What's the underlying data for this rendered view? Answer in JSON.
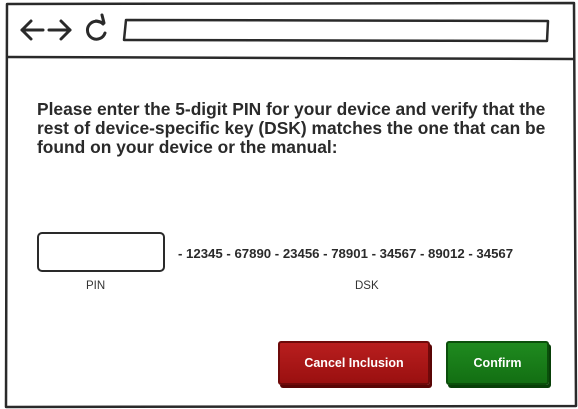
{
  "browser": {
    "back_icon": "arrow-left",
    "forward_icon": "arrow-right",
    "reload_icon": "reload",
    "address_value": ""
  },
  "dialog": {
    "message": "Please enter the 5-digit PIN for your device and verify that the rest of device-specific key (DSK) matches the one that can be found on your device or the manual:",
    "pin_value": "",
    "pin_label": "PIN",
    "dsk_value": "- 12345 - 67890 - 23456 - 78901 - 34567 - 89012 - 34567",
    "dsk_label": "DSK",
    "cancel_label": "Cancel Inclusion",
    "confirm_label": "Confirm"
  },
  "colors": {
    "cancel": "#a81616",
    "confirm": "#187a18",
    "stroke": "#2a2a2a"
  }
}
